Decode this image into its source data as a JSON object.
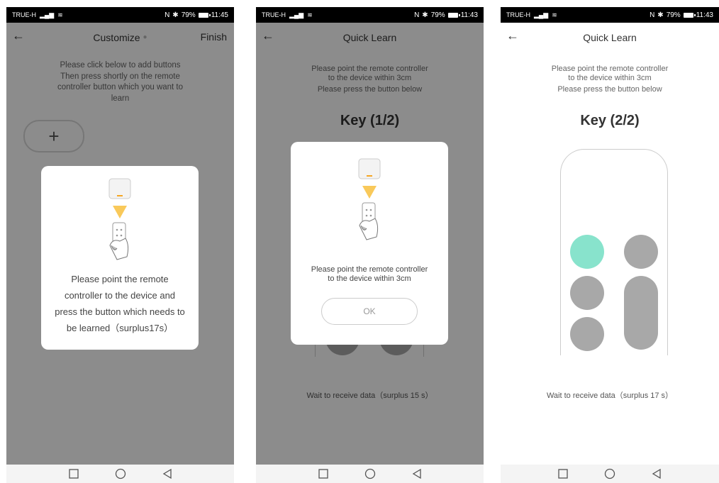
{
  "colors": {
    "accent_green": "#88e3cc",
    "overlay": "rgba(0,0,0,0.45)",
    "button_gray": "#a8a8a8"
  },
  "screen1": {
    "status": {
      "carrier": "TRUE-H",
      "right": "79%",
      "time": "11:45"
    },
    "header": {
      "title": "Customize",
      "finish": "Finish"
    },
    "instructions": [
      "Please click below to add buttons",
      "Then press shortly on the remote",
      "controller button which you want to",
      "learn"
    ],
    "add_symbol": "+",
    "dialog_lines": [
      "Please point the remote",
      "controller to the device and",
      "press the button which needs to",
      "be learned（surplus17s）"
    ]
  },
  "screen2": {
    "status": {
      "carrier": "TRUE-H",
      "right": "79%",
      "time": "11:43"
    },
    "header": {
      "title": "Quick Learn"
    },
    "instructions": [
      "Please point the remote controller",
      "to the device within 3cm",
      "Please press the button below"
    ],
    "key_title": "Key (1/2)",
    "dialog_lines": [
      "Please point the remote controller",
      "to the device within 3cm"
    ],
    "ok_label": "OK",
    "wait_text": "Wait to receive data（surplus 15 s）"
  },
  "screen3": {
    "status": {
      "carrier": "TRUE-H",
      "right": "79%",
      "time": "11:43"
    },
    "header": {
      "title": "Quick Learn"
    },
    "instructions": [
      "Please point the remote controller",
      "to the device within 3cm",
      "Please press the button below"
    ],
    "key_title": "Key (2/2)",
    "wait_text": "Wait to receive data（surplus 17 s）"
  },
  "icons": {
    "back": "arrow-left-icon",
    "home": "circle-icon",
    "recents": "square-icon",
    "back_nav": "triangle-back-icon"
  }
}
